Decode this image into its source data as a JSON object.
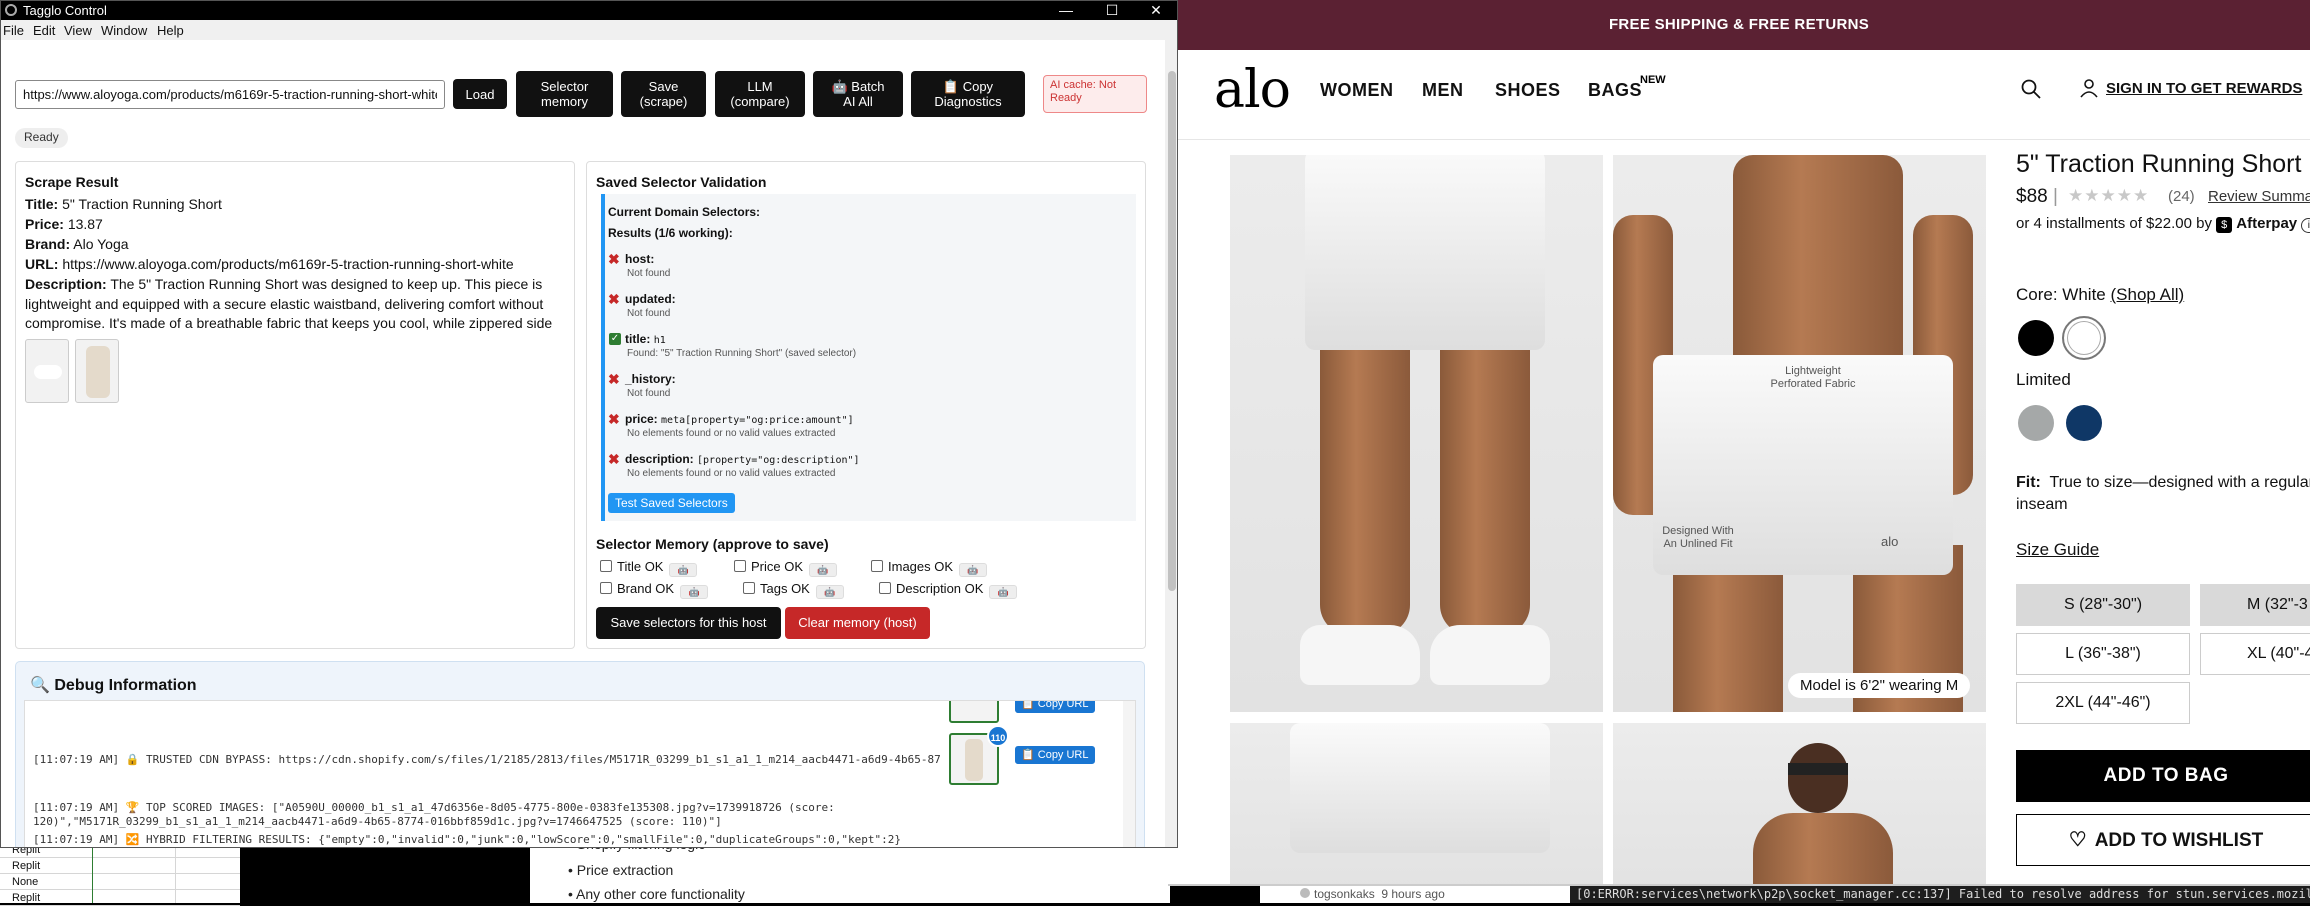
{
  "background": {
    "sheet_rows": [
      "Replit",
      "Replit",
      "None",
      "Replit"
    ],
    "doc_bullets": [
      "Shopify filtering logic",
      "Price extraction",
      "Any other core functionality"
    ],
    "comment": {
      "user": "togsonkaks",
      "time": "9 hours ago"
    },
    "terminal_line": "[0:ERROR:services\\network\\p2p\\socket_manager.cc:137] Failed to resolve address for stun.services.mozilla.com"
  },
  "alo": {
    "banner": "FREE SHIPPING & FREE RETURNS",
    "logo": "alo",
    "nav": [
      "WOMEN",
      "MEN",
      "SHOES",
      "BAGS"
    ],
    "nav_new": "NEW",
    "signin": "SIGN IN TO GET REWARDS",
    "photo_labels": {
      "fabric": "Lightweight\nPerforated Fabric",
      "unlined": "Designed With\nAn Unlined Fit",
      "model": "Model is 6'2\" wearing M",
      "brand_mark": "alo"
    },
    "product": {
      "title": "5\" Traction Running Short",
      "price": "$88",
      "stars": "★★★★★",
      "rating_count": "(24)",
      "review_summary": "Review Summary",
      "installments": "or 4 installments of $22.00 by",
      "afterpay": "Afterpay",
      "color_prefix": "Core: White",
      "shop_all": "(Shop All)",
      "limited": "Limited",
      "fit_label": "Fit:",
      "fit_text": "True to size—designed with a regular inseam",
      "size_guide": "Size Guide",
      "sizes": [
        "S (28\"-30\")",
        "M (32\"-3",
        "L (36\"-38\")",
        "XL (40\"-4",
        "2XL (44\"-46\")"
      ],
      "add_to_bag": "ADD TO BAG",
      "add_to_wishlist": "ADD TO WISHLIST"
    },
    "colors": {
      "banner": "#5b2133",
      "black": "#000000",
      "white": "#ffffff",
      "gray": "#a5a8a8",
      "navy": "#0f3766"
    }
  },
  "window": {
    "title": "Tagglo Control",
    "controls": [
      "—",
      "☐",
      "✕"
    ],
    "menu": [
      "File",
      "Edit",
      "View",
      "Window",
      "Help"
    ]
  },
  "toolbar": {
    "url": "https://www.aloyoga.com/products/m6169r-5-traction-running-short-white",
    "load": "Load",
    "selector_memory": "Selector\nmemory",
    "save_scrape": "Save\n(scrape)",
    "llm_compare": "LLM\n(compare)",
    "batch_ai": "🤖 Batch\nAI All",
    "copy_diag": "📋 Copy\nDiagnostics",
    "ai_cache": "AI cache: Not\nReady",
    "status": "Ready"
  },
  "scrape_result": {
    "heading": "Scrape Result",
    "title_label": "Title:",
    "title": "5\" Traction Running Short",
    "price_label": "Price:",
    "price": "13.87",
    "brand_label": "Brand:",
    "brand": "Alo Yoga",
    "url_label": "URL:",
    "url": "https://www.aloyoga.com/products/m6169r-5-traction-running-short-white",
    "desc_label": "Description:",
    "description": "The 5\" Traction Running Short was designed to keep up. This piece is lightweight and equipped with a secure elastic waistband, delivering comfort without compromise. It's made of a breathable fabric that keeps you cool, while zippered side"
  },
  "validation": {
    "heading": "Saved Selector Validation",
    "current": "Current Domain Selectors:",
    "results": "Results (1/6 working):",
    "items": [
      {
        "key": "host:",
        "selector": "",
        "detail": "Not found",
        "ok": false
      },
      {
        "key": "updated:",
        "selector": "",
        "detail": "Not found",
        "ok": false
      },
      {
        "key": "title:",
        "selector": "h1",
        "detail": "Found: \"5\" Traction Running Short\" (saved selector)",
        "ok": true
      },
      {
        "key": "_history:",
        "selector": "",
        "detail": "Not found",
        "ok": false
      },
      {
        "key": "price:",
        "selector": "meta[property=\"og:price:amount\"]",
        "detail": "No elements found or no valid values extracted",
        "ok": false
      },
      {
        "key": "description:",
        "selector": "[property=\"og:description\"]",
        "detail": "No elements found or no valid values extracted",
        "ok": false
      }
    ],
    "test_button": "Test Saved Selectors"
  },
  "selector_memory": {
    "heading": "Selector Memory (approve to save)",
    "checks": [
      "Title OK",
      "Price OK",
      "Images OK",
      "Brand OK",
      "Tags OK",
      "Description OK"
    ],
    "save": "Save selectors for this host",
    "clear": "Clear memory (host)"
  },
  "debug": {
    "heading": "🔍 Debug Information",
    "lines": [
      "[11:07:19 AM] 🔒 TRUSTED CDN BYPASS: https://cdn.shopify.com/s/files/1/2185/2813/files/M5171R_03299_b1_s1_a1_1_m214_aacb4471-a6d9-4b65-87",
      "[11:07:19 AM] 🏆 TOP SCORED IMAGES: [\"A0590U_00000_b1_s1_a1_47d6356e-8d05-4775-800e-0383fe135308.jpg?v=1739918726 (score:",
      "120)\",\"M5171R_03299_b1_s1_a1_1_m214_aacb4471-a6d9-4b65-8774-016bbf859d1c.jpg?v=1746647525 (score: 110)\"]",
      "[11:07:19 AM] 🔀 HYBRID FILTERING RESULTS: {\"empty\":0,\"invalid\":0,\"junk\":0,\"lowScore\":0,\"smallFile\":0,\"duplicateGroups\":0,\"kept\":2}"
    ],
    "copy_url": "📋 Copy URL",
    "badge": "110"
  }
}
